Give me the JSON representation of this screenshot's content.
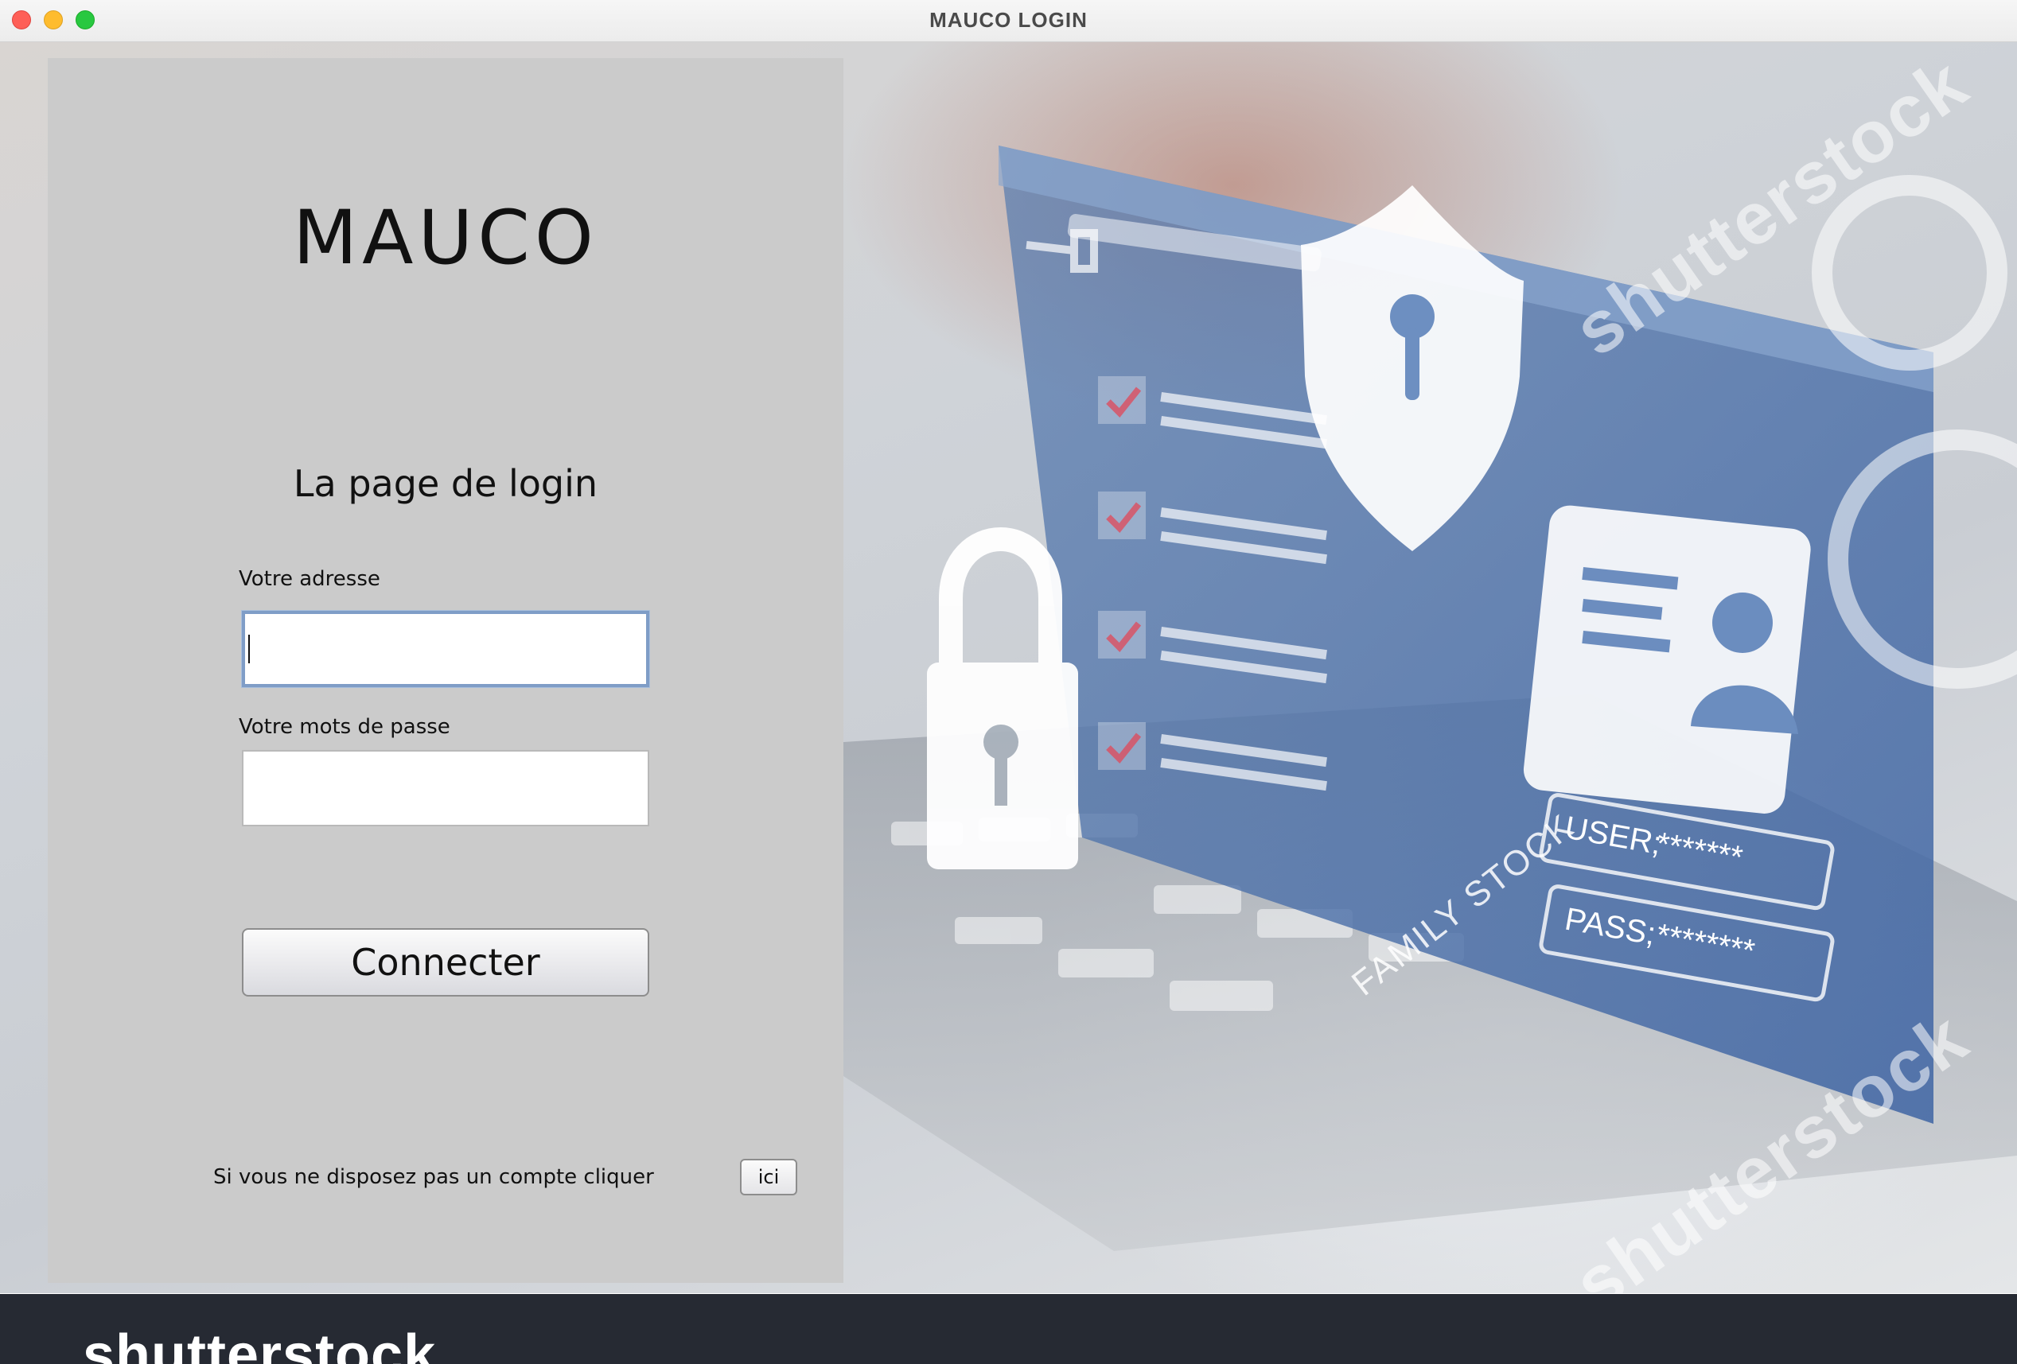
{
  "window": {
    "title": "MAUCO LOGIN"
  },
  "background": {
    "watermark": "shutterstock",
    "stock_label": "FAMILY STOCK",
    "user_label": "USER;",
    "user_value": "*******",
    "pass_label": "PASS;",
    "pass_value": "********",
    "footer_logo": "shutterstock"
  },
  "login": {
    "app_name": "MAUCO",
    "page_title": "La page de login",
    "email_label": "Votre adresse",
    "email_value": "",
    "password_label": "Votre mots de passe",
    "password_value": "",
    "connect_label": "Connecter",
    "signup_text": "Si vous ne disposez pas un compte cliquer",
    "signup_button_label": "ici"
  },
  "colors": {
    "panel": "#cbcbcb",
    "focus_ring": "#7f9dc7",
    "footer": "#262a33"
  }
}
